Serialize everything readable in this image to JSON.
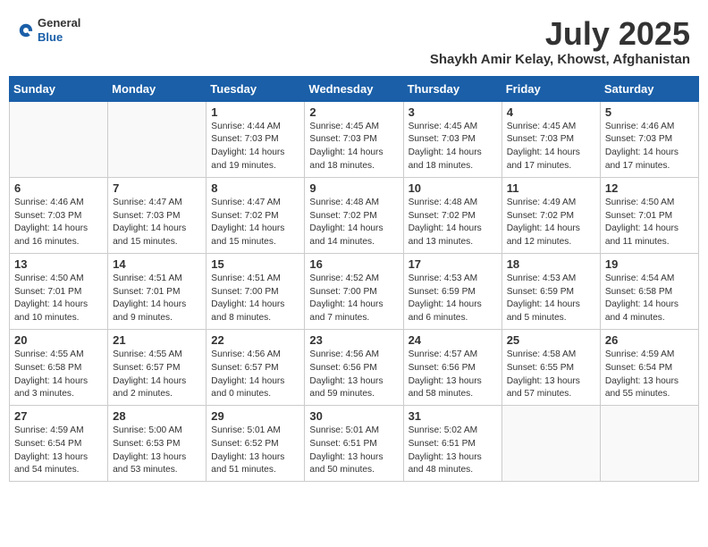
{
  "header": {
    "logo_general": "General",
    "logo_blue": "Blue",
    "month_title": "July 2025",
    "subtitle": "Shaykh Amir Kelay, Khowst, Afghanistan"
  },
  "days_of_week": [
    "Sunday",
    "Monday",
    "Tuesday",
    "Wednesday",
    "Thursday",
    "Friday",
    "Saturday"
  ],
  "weeks": [
    [
      {
        "day": "",
        "info": ""
      },
      {
        "day": "",
        "info": ""
      },
      {
        "day": "1",
        "info": "Sunrise: 4:44 AM\nSunset: 7:03 PM\nDaylight: 14 hours and 19 minutes."
      },
      {
        "day": "2",
        "info": "Sunrise: 4:45 AM\nSunset: 7:03 PM\nDaylight: 14 hours and 18 minutes."
      },
      {
        "day": "3",
        "info": "Sunrise: 4:45 AM\nSunset: 7:03 PM\nDaylight: 14 hours and 18 minutes."
      },
      {
        "day": "4",
        "info": "Sunrise: 4:45 AM\nSunset: 7:03 PM\nDaylight: 14 hours and 17 minutes."
      },
      {
        "day": "5",
        "info": "Sunrise: 4:46 AM\nSunset: 7:03 PM\nDaylight: 14 hours and 17 minutes."
      }
    ],
    [
      {
        "day": "6",
        "info": "Sunrise: 4:46 AM\nSunset: 7:03 PM\nDaylight: 14 hours and 16 minutes."
      },
      {
        "day": "7",
        "info": "Sunrise: 4:47 AM\nSunset: 7:03 PM\nDaylight: 14 hours and 15 minutes."
      },
      {
        "day": "8",
        "info": "Sunrise: 4:47 AM\nSunset: 7:02 PM\nDaylight: 14 hours and 15 minutes."
      },
      {
        "day": "9",
        "info": "Sunrise: 4:48 AM\nSunset: 7:02 PM\nDaylight: 14 hours and 14 minutes."
      },
      {
        "day": "10",
        "info": "Sunrise: 4:48 AM\nSunset: 7:02 PM\nDaylight: 14 hours and 13 minutes."
      },
      {
        "day": "11",
        "info": "Sunrise: 4:49 AM\nSunset: 7:02 PM\nDaylight: 14 hours and 12 minutes."
      },
      {
        "day": "12",
        "info": "Sunrise: 4:50 AM\nSunset: 7:01 PM\nDaylight: 14 hours and 11 minutes."
      }
    ],
    [
      {
        "day": "13",
        "info": "Sunrise: 4:50 AM\nSunset: 7:01 PM\nDaylight: 14 hours and 10 minutes."
      },
      {
        "day": "14",
        "info": "Sunrise: 4:51 AM\nSunset: 7:01 PM\nDaylight: 14 hours and 9 minutes."
      },
      {
        "day": "15",
        "info": "Sunrise: 4:51 AM\nSunset: 7:00 PM\nDaylight: 14 hours and 8 minutes."
      },
      {
        "day": "16",
        "info": "Sunrise: 4:52 AM\nSunset: 7:00 PM\nDaylight: 14 hours and 7 minutes."
      },
      {
        "day": "17",
        "info": "Sunrise: 4:53 AM\nSunset: 6:59 PM\nDaylight: 14 hours and 6 minutes."
      },
      {
        "day": "18",
        "info": "Sunrise: 4:53 AM\nSunset: 6:59 PM\nDaylight: 14 hours and 5 minutes."
      },
      {
        "day": "19",
        "info": "Sunrise: 4:54 AM\nSunset: 6:58 PM\nDaylight: 14 hours and 4 minutes."
      }
    ],
    [
      {
        "day": "20",
        "info": "Sunrise: 4:55 AM\nSunset: 6:58 PM\nDaylight: 14 hours and 3 minutes."
      },
      {
        "day": "21",
        "info": "Sunrise: 4:55 AM\nSunset: 6:57 PM\nDaylight: 14 hours and 2 minutes."
      },
      {
        "day": "22",
        "info": "Sunrise: 4:56 AM\nSunset: 6:57 PM\nDaylight: 14 hours and 0 minutes."
      },
      {
        "day": "23",
        "info": "Sunrise: 4:56 AM\nSunset: 6:56 PM\nDaylight: 13 hours and 59 minutes."
      },
      {
        "day": "24",
        "info": "Sunrise: 4:57 AM\nSunset: 6:56 PM\nDaylight: 13 hours and 58 minutes."
      },
      {
        "day": "25",
        "info": "Sunrise: 4:58 AM\nSunset: 6:55 PM\nDaylight: 13 hours and 57 minutes."
      },
      {
        "day": "26",
        "info": "Sunrise: 4:59 AM\nSunset: 6:54 PM\nDaylight: 13 hours and 55 minutes."
      }
    ],
    [
      {
        "day": "27",
        "info": "Sunrise: 4:59 AM\nSunset: 6:54 PM\nDaylight: 13 hours and 54 minutes."
      },
      {
        "day": "28",
        "info": "Sunrise: 5:00 AM\nSunset: 6:53 PM\nDaylight: 13 hours and 53 minutes."
      },
      {
        "day": "29",
        "info": "Sunrise: 5:01 AM\nSunset: 6:52 PM\nDaylight: 13 hours and 51 minutes."
      },
      {
        "day": "30",
        "info": "Sunrise: 5:01 AM\nSunset: 6:51 PM\nDaylight: 13 hours and 50 minutes."
      },
      {
        "day": "31",
        "info": "Sunrise: 5:02 AM\nSunset: 6:51 PM\nDaylight: 13 hours and 48 minutes."
      },
      {
        "day": "",
        "info": ""
      },
      {
        "day": "",
        "info": ""
      }
    ]
  ]
}
